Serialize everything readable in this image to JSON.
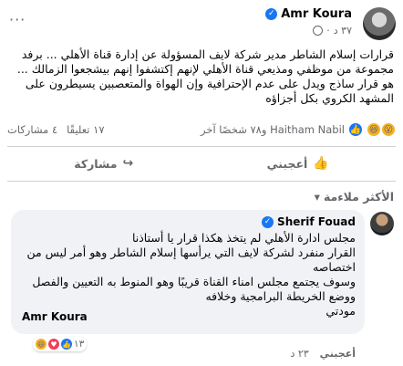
{
  "post": {
    "author": "Amr Koura",
    "time": "٣٧ د",
    "text": "قرارات إسلام الشاطر مدير شركة لايف المسؤولة عن إدارة قناة الأهلي ... برفد مجموعة من موظفي ومذيعي قناة الأهلي لإنهم إكتشفوا إنهم بيشجعوا الزمالك ... هو قرار ساذج ويدل على عدم الإحترافية وإن الهواة والمتعصبين يسيطرون على المشهد الكروي بكل أجزاؤه",
    "reactions_summary": "Haitham Nabil و٧٨ شخصًا آخر",
    "comments_count": "١٧ تعليقًا",
    "shares_count": "٤ مشاركات"
  },
  "actions": {
    "like": "أعجبني",
    "share": "مشاركة"
  },
  "sort": {
    "label": "الأكثر ملاءمة"
  },
  "comment": {
    "author": "Sherif Fouad",
    "lines": [
      "مجلس ادارة الأهلي لم يتخذ هكذا قرار يا أستاذنا",
      "القرار منفرد لشركة لايف التي يرأسها إسلام الشاطر وهو أمر ليس من اختصاصه",
      "وسوف يجتمع مجلس امناء القناة قريبًا وهو المنوط به التعيين والفصل ووضع الخريطة البرامجية وخلافه",
      "مودتي"
    ],
    "signature": "Amr Koura",
    "reactions_count": "١٣",
    "like_label": "أعجبني",
    "time": "٢٣ د"
  },
  "colors": {
    "facebook_blue": "#1877f2",
    "secondary_text": "#65676b",
    "bubble_bg": "#f0f2f5"
  },
  "icons": {
    "verified": "verified-badge-icon",
    "globe": "globe-icon",
    "like": "thumbs-up-icon",
    "share": "share-arrow-icon",
    "more": "more-dots-icon"
  }
}
